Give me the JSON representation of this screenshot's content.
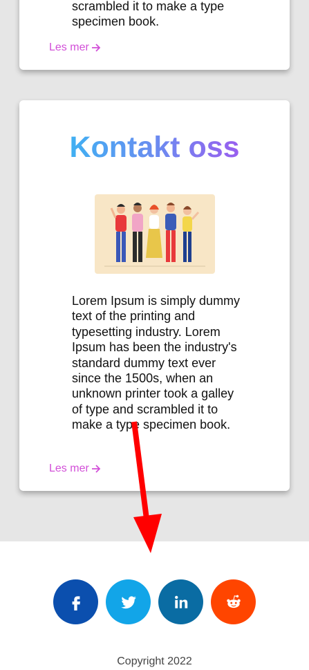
{
  "cards": [
    {
      "text": "scrambled it to make a type specimen book.",
      "read_more": "Les mer"
    },
    {
      "title": "Kontakt oss",
      "illustration_icon": "people-group-illustration",
      "text": "Lorem Ipsum is simply dummy text of the printing and typesetting industry. Lorem Ipsum has been the industry's standard dummy text ever since the 1500s, when an unknown printer took a galley of type and scrambled it to make a type specimen book.",
      "read_more": "Les mer"
    }
  ],
  "social": [
    {
      "icon": "facebook-icon",
      "color": "#0b4fae"
    },
    {
      "icon": "twitter-icon",
      "color": "#12a5e8"
    },
    {
      "icon": "linkedin-icon",
      "color": "#0a6ca3"
    },
    {
      "icon": "reddit-icon",
      "color": "#ff4500"
    }
  ],
  "footer": {
    "copyright": "Copyright 2022"
  },
  "colors": {
    "link": "#d24fd8",
    "title_gradient_start": "#27c6f4",
    "title_gradient_end": "#b544ee",
    "annotation_arrow": "#ff0000"
  }
}
